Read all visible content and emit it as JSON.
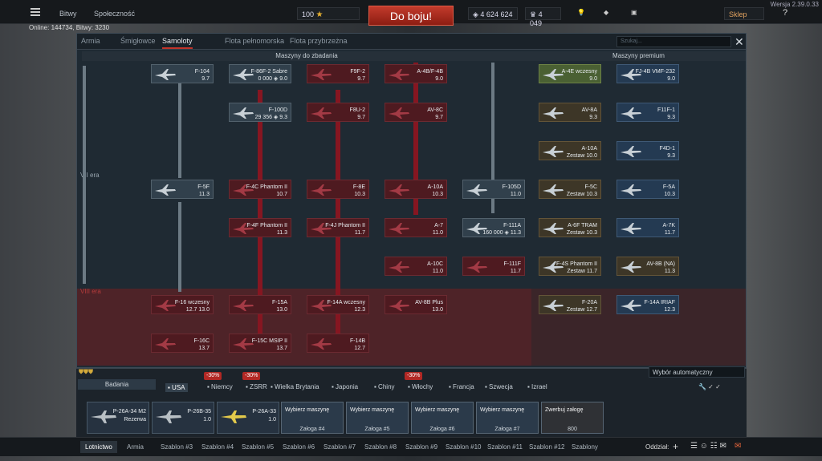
{
  "version": "Wersja 2.39.0.33",
  "topbar": {
    "battles": "Bitwy",
    "community": "Społeczność",
    "premium_count": "100",
    "silver": "4 624 624",
    "gold": "4 049",
    "battle_button": "Do boju!",
    "shop": "Sklep"
  },
  "online": "Online: 144734, Bitwy: 3230",
  "tabs": [
    "Armia",
    "Śmigłowce",
    "Samoloty",
    "Flota pełnomorska",
    "Flota przybrzeżna"
  ],
  "search_placeholder": "Szukaj...",
  "headers": {
    "research": "Maszyny do zbadania",
    "premium": "Maszyny premium"
  },
  "era_label": "VII era",
  "era8": "VIII era",
  "vehicles": [
    {
      "n": "F-104",
      "b": "9.7",
      "s": "own"
    },
    {
      "n": "F-86F-2 Sabre",
      "b": "0 000 ◈ 9.0",
      "s": "own"
    },
    {
      "n": "F9F-2",
      "b": "9.7",
      "s": "res"
    },
    {
      "n": "A-4B/F-4B",
      "b": "9.0",
      "s": "res"
    },
    {
      "n": "A-4E wczesny",
      "b": "9.0",
      "s": "green"
    },
    {
      "n": "FJ-4B VMF-232",
      "b": "9.0",
      "s": "blue"
    },
    {
      "n": "F-100D",
      "b": "29 356 ◈ 9.3",
      "s": "own"
    },
    {
      "n": "F8U-2",
      "b": "9.7",
      "s": "res"
    },
    {
      "n": "AV-8C",
      "b": "9.7",
      "s": "res"
    },
    {
      "n": "AV-8A",
      "b": "9.3",
      "s": "prem"
    },
    {
      "n": "F11F-1",
      "b": "9.3",
      "s": "blue"
    },
    {
      "n": "A-10A",
      "b": "Zestaw 10.0",
      "s": "prem"
    },
    {
      "n": "F4D-1",
      "b": "9.3",
      "s": "blue"
    },
    {
      "n": "F-5F",
      "b": "11.3",
      "s": "own"
    },
    {
      "n": "F-4C Phantom II",
      "b": "10.7",
      "s": "res"
    },
    {
      "n": "F-8E",
      "b": "10.3",
      "s": "res"
    },
    {
      "n": "A-10A",
      "b": "10.3",
      "s": "res"
    },
    {
      "n": "F-105D",
      "b": "11.0",
      "s": "own"
    },
    {
      "n": "F-5C",
      "b": "Zestaw 10.3",
      "s": "prem"
    },
    {
      "n": "F-5A",
      "b": "10.3",
      "s": "blue"
    },
    {
      "n": "F-4F Phantom II",
      "b": "11.3",
      "s": "res"
    },
    {
      "n": "F-4J Phantom II",
      "b": "11.7",
      "s": "res"
    },
    {
      "n": "A-7",
      "b": "11.0",
      "s": "res"
    },
    {
      "n": "F-111A",
      "b": "160 000 ◈ 11.3",
      "s": "own"
    },
    {
      "n": "A-6F TRAM",
      "b": "Zestaw 10.3",
      "s": "prem"
    },
    {
      "n": "A-7K",
      "b": "11.7",
      "s": "blue"
    },
    {
      "n": "A-10C",
      "b": "11.0",
      "s": "res"
    },
    {
      "n": "F-111F",
      "b": "11.7",
      "s": "res"
    },
    {
      "n": "F-4S Phantom II",
      "b": "Zestaw 11.7",
      "s": "prem"
    },
    {
      "n": "AV-8B (NA)",
      "b": "11.3",
      "s": "prem"
    },
    {
      "n": "F-16 wczesny",
      "b": "12.7 13.0",
      "s": "res"
    },
    {
      "n": "F-15A",
      "b": "13.0",
      "s": "res"
    },
    {
      "n": "F-14A wczesny",
      "b": "12.3",
      "s": "res"
    },
    {
      "n": "AV-8B Plus",
      "b": "13.0",
      "s": "res"
    },
    {
      "n": "F-20A",
      "b": "Zestaw 12.7",
      "s": "prem"
    },
    {
      "n": "F-14A IRIAF",
      "b": "12.3",
      "s": "blue"
    },
    {
      "n": "F-16C",
      "b": "13.7",
      "s": "res"
    },
    {
      "n": "F-15C MSIP II",
      "b": "13.7",
      "s": "res"
    },
    {
      "n": "F-14B",
      "b": "12.7",
      "s": "res"
    }
  ],
  "research_label": "Badania",
  "discount": "-30%",
  "nations": [
    "USA",
    "Niemcy",
    "ZSRR",
    "Wielka Brytania",
    "Japonia",
    "Chiny",
    "Włochy",
    "Francja",
    "Szwecja",
    "Izrael"
  ],
  "auto_select": "Wybór automatyczny",
  "slots": [
    {
      "n": "P-26A-34 M2",
      "s": "Rezerwa"
    },
    {
      "n": "P-26B-35",
      "s": "1.0"
    },
    {
      "n": "P-26A-33",
      "s": "1.0"
    }
  ],
  "crew": [
    {
      "t": "Wybierz maszynę",
      "b": "Załoga #4"
    },
    {
      "t": "Wybierz maszynę",
      "b": "Załoga #5"
    },
    {
      "t": "Wybierz maszynę",
      "b": "Załoga #6"
    },
    {
      "t": "Wybierz maszynę",
      "b": "Załoga #7"
    }
  ],
  "recruit": "Zwerbuj załogę",
  "recruit_cost": "800",
  "footer_tabs": [
    "Lotnictwo",
    "Armia",
    "Szablon #3",
    "Szablon #4",
    "Szablon #5",
    "Szablon #6",
    "Szablon #7",
    "Szablon #8",
    "Szablon #9",
    "Szablon #10",
    "Szablon #11",
    "Szablon #12",
    "Szablony"
  ],
  "squad": "Oddział:",
  "colors": {
    "battle": "#c23b2c",
    "research": "#4e1a20",
    "owned": "#31404c"
  }
}
